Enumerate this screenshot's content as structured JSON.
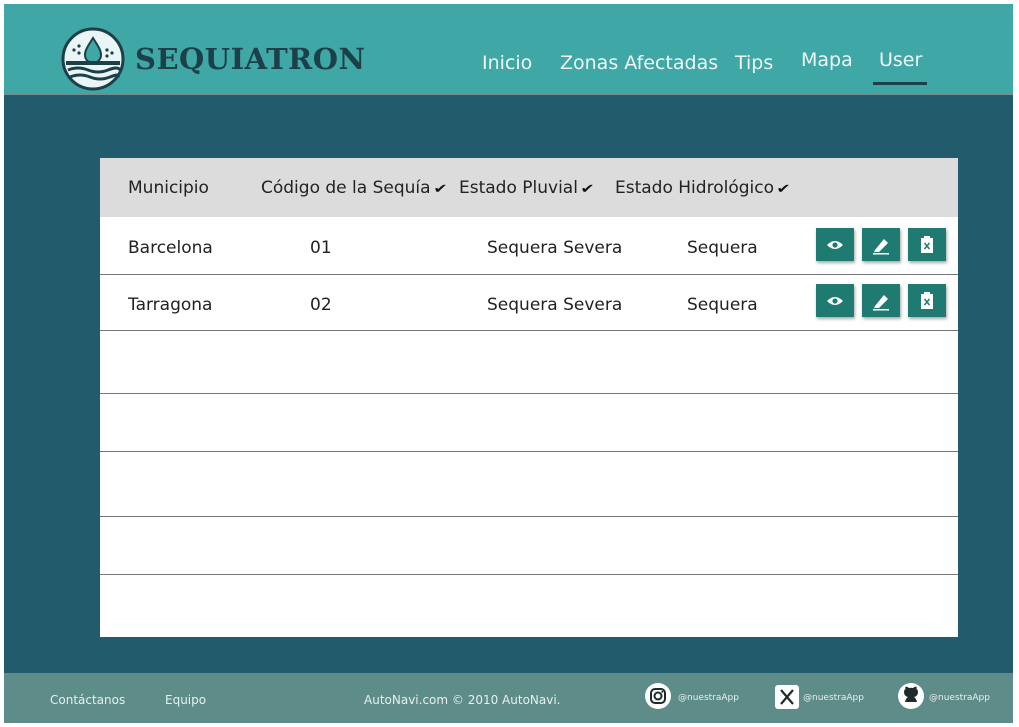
{
  "brand": {
    "name": "SEQUIATRON"
  },
  "nav": {
    "items": [
      {
        "label": "Inicio"
      },
      {
        "label": "Zonas Afectadas"
      },
      {
        "label": "Tips"
      },
      {
        "label": "Mapa"
      },
      {
        "label": "User",
        "active": true
      }
    ]
  },
  "table": {
    "headers": [
      {
        "label": "Municipio",
        "sortable": false
      },
      {
        "label": "Código de la Sequía",
        "sortable": true
      },
      {
        "label": "Estado Pluvial",
        "sortable": true
      },
      {
        "label": "Estado Hidrológico",
        "sortable": true
      }
    ],
    "rows": [
      {
        "municipio": "Barcelona",
        "codigo": "01",
        "pluvial": "Sequera Severa",
        "hidrologico": "Sequera"
      },
      {
        "municipio": "Tarragona",
        "codigo": "02",
        "pluvial": "Sequera Severa",
        "hidrologico": "Sequera"
      }
    ],
    "actions": [
      "view-icon",
      "edit-icon",
      "delete-icon"
    ]
  },
  "footer": {
    "contact": "Contáctanos",
    "team": "Equipo",
    "copyright": "AutoNavi.com © 2010 AutoNavi.",
    "socials": [
      {
        "icon": "instagram-icon",
        "handle": "@nuestraApp"
      },
      {
        "icon": "x-icon",
        "handle": "@nuestraApp"
      },
      {
        "icon": "github-icon",
        "handle": "@nuestraApp"
      }
    ]
  },
  "colors": {
    "header": "#3fa7a6",
    "background": "#225b6c",
    "action_button": "#1f7b72",
    "footer": "#5e8c89",
    "table_header": "#dcdcdc"
  }
}
